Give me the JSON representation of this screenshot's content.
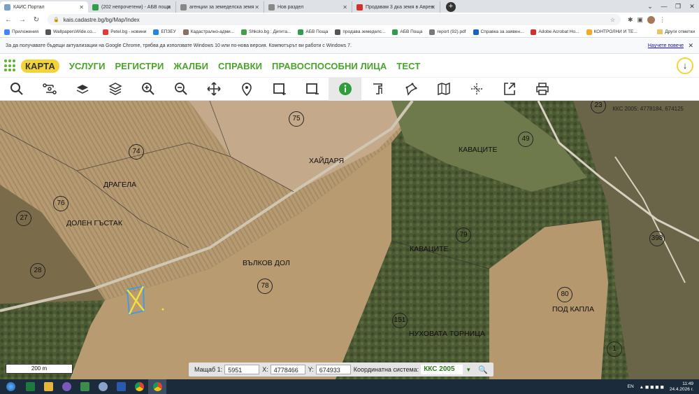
{
  "browser": {
    "tabs": [
      {
        "title": "КАИС Портал",
        "icon": "cadastre-favicon",
        "active": true,
        "color": "#7aa0c8"
      },
      {
        "title": "(202 непрочетени) - АБВ поща",
        "icon": "abv-favicon",
        "active": false,
        "color": "#2e9e4a"
      },
      {
        "title": "агенции за земеделска земя",
        "icon": "globe-favicon",
        "active": false,
        "color": "#777"
      },
      {
        "title": "Нов раздел",
        "icon": "globe-favicon",
        "active": false,
        "color": "#777"
      },
      {
        "title": "Продавам 3 дка земя в Аврен",
        "icon": "imot-favicon",
        "active": false,
        "color": "#d0312d"
      }
    ],
    "new_tab": "+",
    "url": "kais.cadastre.bg/bg/Map/Index",
    "bookmarks": [
      "Приложения",
      "WallpapersWide.co...",
      "Petel.bg - новини",
      "ЕПЗЕУ",
      "Кадастрално-адми...",
      "Shkolo.bg : Дигита...",
      "АБВ Поща",
      "продава земеделс...",
      "АБВ Поща",
      "report (92).pdf",
      "Справка за заявен...",
      "Adobe Acrobat Ho...",
      "КОНТРОЛНИ И ТЕ..."
    ],
    "bookmarks_other": "Други отметки",
    "infobar_text": "За да получавате бъдещи актуализации на Google Chrome, трябва да използвате Windows 10 или по-нова версия. Компютърът ви работи с Windows 7.",
    "infobar_link": "Научете повече"
  },
  "menu": [
    "КАРТА",
    "УСЛУГИ",
    "РЕГИСТРИ",
    "ЖАЛБИ",
    "СПРАВКИ",
    "ПРАВОСПОСОБНИ ЛИЦА",
    "ТЕСТ"
  ],
  "tools": [
    "search-icon",
    "route-icon",
    "layers-icon",
    "layers-stack-icon",
    "zoom-in-icon",
    "zoom-out-icon",
    "pan-icon",
    "location-pin-icon",
    "select-area-icon",
    "clear-selection-icon",
    "info-icon",
    "building-icon",
    "polygon-icon",
    "map-icon",
    "measure-icon",
    "export-icon",
    "print-icon"
  ],
  "map": {
    "coord_readout": "ККС 2005: 4778184, 674125",
    "place_names": [
      "ХАЙДАРЯ",
      "КАВАЦИТЕ",
      "ДРАГЕЛА",
      "ДОЛЕН ГЪСТАК",
      "ВЪЛКОВ ДОЛ",
      "КАВАЦИТЕ",
      "ПОД КАПЛА",
      "НУХОВАТА ТОРНИЦА"
    ],
    "parcels": [
      "75",
      "74",
      "49",
      "23",
      "76",
      "27",
      "79",
      "398",
      "28",
      "78",
      "80",
      "151",
      "1"
    ],
    "scale_label": "200 m",
    "coords": {
      "scale_label": "Мащаб 1:",
      "scale_value": "5951",
      "x_label": "X:",
      "x_value": "4778466",
      "y_label": "Y:",
      "y_value": "674933",
      "system_label": "Координатна система:",
      "system_value": "ККС 2005"
    }
  },
  "taskbar": {
    "language": "EN",
    "time": "11:49",
    "date": "24.4.2026 г."
  },
  "colors": {
    "accent": "#4aa32a",
    "active_menu": "#f2d43a"
  }
}
